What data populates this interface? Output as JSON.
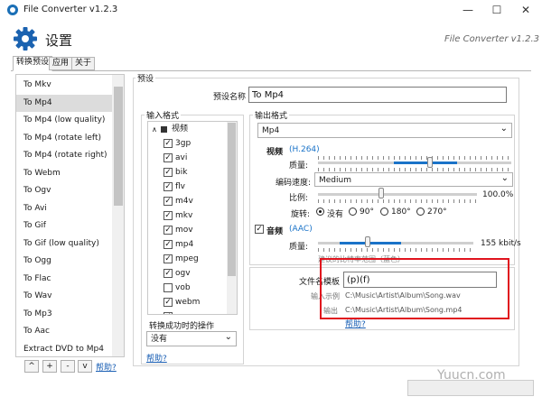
{
  "window": {
    "title": "File Converter v1.2.3",
    "brand": "File Converter v1.2.3"
  },
  "header": {
    "title": "设置"
  },
  "tabs": [
    "转换预设",
    "应用",
    "关于"
  ],
  "presets": [
    "To Mkv",
    "To Mp4",
    "To Mp4 (low quality)",
    "To Mp4 (rotate left)",
    "To Mp4 (rotate right)",
    "To Webm",
    "To Ogv",
    "To Avi",
    "To Gif",
    "To Gif (low quality)",
    "To Ogg",
    "To Flac",
    "To Wav",
    "To Mp3",
    "To Aac",
    "Extract DVD to Mp4"
  ],
  "selected_preset": "To Mp4",
  "list_buttons": {
    "up": "^",
    "add": "+",
    "remove": "-",
    "down": "v",
    "help": "帮助?"
  },
  "preset_group": {
    "label": "预设",
    "name_label": "预设名称",
    "name_value": "To Mp4"
  },
  "input_format": {
    "label": "输入格式",
    "root": "视频",
    "items": [
      {
        "name": "3gp",
        "checked": true
      },
      {
        "name": "avi",
        "checked": true
      },
      {
        "name": "bik",
        "checked": true
      },
      {
        "name": "flv",
        "checked": true
      },
      {
        "name": "m4v",
        "checked": true
      },
      {
        "name": "mkv",
        "checked": true
      },
      {
        "name": "mov",
        "checked": true
      },
      {
        "name": "mp4",
        "checked": true
      },
      {
        "name": "mpeg",
        "checked": true
      },
      {
        "name": "ogv",
        "checked": true
      },
      {
        "name": "vob",
        "checked": false
      },
      {
        "name": "webm",
        "checked": true
      },
      {
        "name": "wmv",
        "checked": true
      }
    ],
    "after_label": "转换成功时的操作",
    "after_value": "没有",
    "help": "帮助?"
  },
  "output_format": {
    "label": "输出格式",
    "value": "Mp4",
    "video_label": "视频",
    "video_codec": "(H.264)",
    "quality_label": "质量:",
    "quality_level": 0.58,
    "speed_label": "编码速度:",
    "speed_value": "Medium",
    "scale_label": "比例:",
    "scale_value": "100.0%",
    "scale_level": 0.4,
    "rotate_label": "旋转:",
    "rotate_options": [
      "没有",
      "90°",
      "180°",
      "270°"
    ],
    "audio_label": "音频",
    "audio_codec": "(AAC)",
    "audio_quality_label": "质量:",
    "audio_quality_value": "155 kbit/s",
    "audio_quality_level": 0.32,
    "audio_hint": "建议的比特率范围（蓝色）"
  },
  "file_template": {
    "label": "文件名模板",
    "value": "(p)(f)",
    "example_label": "输入示例",
    "example_value": "C:\\Music\\Artist\\Album\\Song.wav",
    "output_label": "输出",
    "output_value": "C:\\Music\\Artist\\Album\\Song.mp4",
    "help": "帮助?"
  },
  "watermark": "Yuucn.com",
  "colors": {
    "accent": "#1a73c8",
    "highlight_box": "#e0141e",
    "link": "#1a5fb4"
  }
}
